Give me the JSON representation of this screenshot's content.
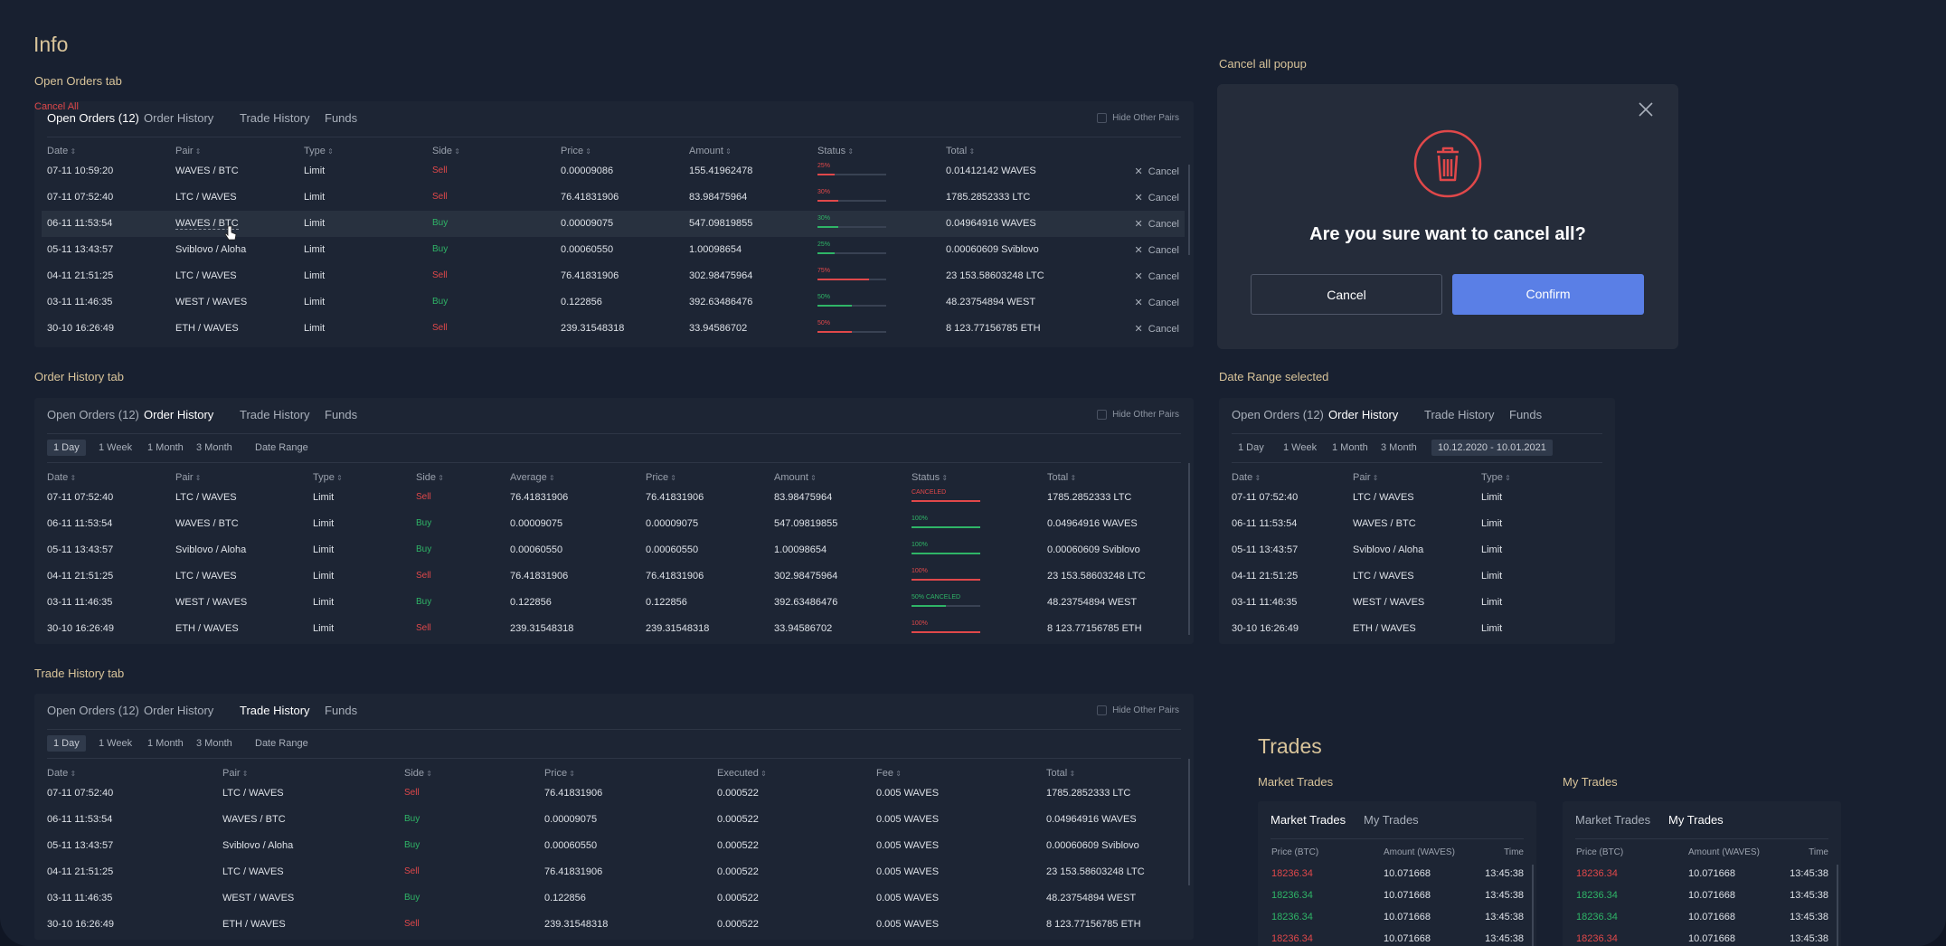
{
  "title": "Info",
  "sections": {
    "open_orders": "Open Orders tab",
    "order_history": "Order History tab",
    "trade_history": "Trade History tab",
    "cancel_popup": "Cancel all popup",
    "date_range": "Date Range selected"
  },
  "tabs": [
    "Open Orders (12)",
    "Order History",
    "Trade History",
    "Funds"
  ],
  "hide_other_pairs": "Hide Other Pairs",
  "filters": [
    "1 Day",
    "1 Week",
    "1 Month",
    "3 Month",
    "Date Range"
  ],
  "date_range_value": "10.12.2020 - 10.01.2021",
  "open_orders": {
    "headers": [
      "Date",
      "Pair",
      "Type",
      "Side",
      "Price",
      "Amount",
      "Status",
      "Total"
    ],
    "cancel_all": "Cancel All",
    "cancel_label": "Cancel",
    "rows": [
      {
        "date": "07-11 10:59:20",
        "pair": "WAVES / BTC",
        "type": "Limit",
        "side": "Sell",
        "price": "0.00009086",
        "amount": "155.41962478",
        "status": "25%",
        "fill": 0.25,
        "total": "0.01412142 WAVES"
      },
      {
        "date": "07-11 07:52:40",
        "pair": "LTC / WAVES",
        "type": "Limit",
        "side": "Sell",
        "price": "76.41831906",
        "amount": "83.98475964",
        "status": "30%",
        "fill": 0.3,
        "total": "1785.2852333 LTC"
      },
      {
        "date": "06-11 11:53:54",
        "pair": "WAVES / BTC",
        "type": "Limit",
        "side": "Buy",
        "price": "0.00009075",
        "amount": "547.09819855",
        "status": "30%",
        "fill": 0.3,
        "total": "0.04964916 WAVES"
      },
      {
        "date": "05-11 13:43:57",
        "pair": "Sviblovo / Aloha",
        "type": "Limit",
        "side": "Buy",
        "price": "0.00060550",
        "amount": "1.00098654",
        "status": "25%",
        "fill": 0.25,
        "total": "0.00060609 Sviblovo"
      },
      {
        "date": "04-11 21:51:25",
        "pair": "LTC / WAVES",
        "type": "Limit",
        "side": "Sell",
        "price": "76.41831906",
        "amount": "302.98475964",
        "status": "75%",
        "fill": 0.75,
        "total": "23 153.58603248 LTC"
      },
      {
        "date": "03-11 11:46:35",
        "pair": "WEST / WAVES",
        "type": "Limit",
        "side": "Buy",
        "price": "0.122856",
        "amount": "392.63486476",
        "status": "50%",
        "fill": 0.5,
        "total": "48.23754894 WEST"
      },
      {
        "date": "30-10 16:26:49",
        "pair": "ETH / WAVES",
        "type": "Limit",
        "side": "Sell",
        "price": "239.31548318",
        "amount": "33.94586702",
        "status": "50%",
        "fill": 0.5,
        "total": "8 123.77156785 ETH"
      }
    ]
  },
  "order_history": {
    "headers": [
      "Date",
      "Pair",
      "Type",
      "Side",
      "Average",
      "Price",
      "Amount",
      "Status",
      "Total"
    ],
    "rows": [
      {
        "date": "07-11 07:52:40",
        "pair": "LTC / WAVES",
        "type": "Limit",
        "side": "Sell",
        "average": "76.41831906",
        "price": "76.41831906",
        "amount": "83.98475964",
        "status": "CANCELED",
        "fill": 1,
        "total": "1785.2852333 LTC"
      },
      {
        "date": "06-11 11:53:54",
        "pair": "WAVES / BTC",
        "type": "Limit",
        "side": "Buy",
        "average": "0.00009075",
        "price": "0.00009075",
        "amount": "547.09819855",
        "status": "100%",
        "fill": 1,
        "total": "0.04964916 WAVES"
      },
      {
        "date": "05-11 13:43:57",
        "pair": "Sviblovo / Aloha",
        "type": "Limit",
        "side": "Buy",
        "average": "0.00060550",
        "price": "0.00060550",
        "amount": "1.00098654",
        "status": "100%",
        "fill": 1,
        "total": "0.00060609 Sviblovo"
      },
      {
        "date": "04-11 21:51:25",
        "pair": "LTC / WAVES",
        "type": "Limit",
        "side": "Sell",
        "average": "76.41831906",
        "price": "76.41831906",
        "amount": "302.98475964",
        "status": "100%",
        "fill": 1,
        "total": "23 153.58603248 LTC"
      },
      {
        "date": "03-11 11:46:35",
        "pair": "WEST / WAVES",
        "type": "Limit",
        "side": "Buy",
        "average": "0.122856",
        "price": "0.122856",
        "amount": "392.63486476",
        "status": "50% CANCELED",
        "fill": 0.5,
        "total": "48.23754894 WEST"
      },
      {
        "date": "30-10 16:26:49",
        "pair": "ETH / WAVES",
        "type": "Limit",
        "side": "Sell",
        "average": "239.31548318",
        "price": "239.31548318",
        "amount": "33.94586702",
        "status": "100%",
        "fill": 1,
        "total": "8 123.77156785 ETH"
      }
    ]
  },
  "trade_history": {
    "headers": [
      "Date",
      "Pair",
      "Side",
      "Price",
      "Executed",
      "Fee",
      "Total"
    ],
    "rows": [
      {
        "date": "07-11 07:52:40",
        "pair": "LTC / WAVES",
        "side": "Sell",
        "price": "76.41831906",
        "executed": "0.000522",
        "fee": "0.005 WAVES",
        "total": "1785.2852333 LTC"
      },
      {
        "date": "06-11 11:53:54",
        "pair": "WAVES / BTC",
        "side": "Buy",
        "price": "0.00009075",
        "executed": "0.000522",
        "fee": "0.005 WAVES",
        "total": "0.04964916 WAVES"
      },
      {
        "date": "05-11 13:43:57",
        "pair": "Sviblovo / Aloha",
        "side": "Buy",
        "price": "0.00060550",
        "executed": "0.000522",
        "fee": "0.005 WAVES",
        "total": "0.00060609 Sviblovo"
      },
      {
        "date": "04-11 21:51:25",
        "pair": "LTC / WAVES",
        "side": "Sell",
        "price": "76.41831906",
        "executed": "0.000522",
        "fee": "0.005 WAVES",
        "total": "23 153.58603248 LTC"
      },
      {
        "date": "03-11 11:46:35",
        "pair": "WEST / WAVES",
        "side": "Buy",
        "price": "0.122856",
        "executed": "0.000522",
        "fee": "0.005 WAVES",
        "total": "48.23754894 WEST"
      },
      {
        "date": "30-10 16:26:49",
        "pair": "ETH / WAVES",
        "side": "Sell",
        "price": "239.31548318",
        "executed": "0.000522",
        "fee": "0.005 WAVES",
        "total": "8 123.77156785 ETH"
      }
    ]
  },
  "date_range_panel": {
    "headers": [
      "Date",
      "Pair",
      "Type"
    ],
    "rows": [
      {
        "date": "07-11 07:52:40",
        "pair": "LTC / WAVES",
        "type": "Limit"
      },
      {
        "date": "06-11 11:53:54",
        "pair": "WAVES / BTC",
        "type": "Limit"
      },
      {
        "date": "05-11 13:43:57",
        "pair": "Sviblovo / Aloha",
        "type": "Limit"
      },
      {
        "date": "04-11 21:51:25",
        "pair": "LTC / WAVES",
        "type": "Limit"
      },
      {
        "date": "03-11 11:46:35",
        "pair": "WEST / WAVES",
        "type": "Limit"
      },
      {
        "date": "30-10 16:26:49",
        "pair": "ETH / WAVES",
        "type": "Limit"
      }
    ]
  },
  "popup": {
    "question": "Are you sure want to cancel all?",
    "cancel": "Cancel",
    "confirm": "Confirm"
  },
  "trades": {
    "title": "Trades",
    "market_label": "Market Trades",
    "my_label": "My Trades",
    "tab_market": "Market Trades",
    "tab_my": "My Trades",
    "headers": [
      "Price (BTC)",
      "Amount (WAVES)",
      "Time"
    ],
    "rows": [
      {
        "price": "18236.34",
        "amount": "10.071668",
        "time": "13:45:38",
        "side": "sell"
      },
      {
        "price": "18236.34",
        "amount": "10.071668",
        "time": "13:45:38",
        "side": "buy"
      },
      {
        "price": "18236.34",
        "amount": "10.071668",
        "time": "13:45:38",
        "side": "buy"
      },
      {
        "price": "18236.34",
        "amount": "10.071668",
        "time": "13:45:38",
        "side": "sell"
      }
    ]
  },
  "colors": {
    "accent": "#5a7fe6",
    "sell": "#e0484a",
    "buy": "#2fb567",
    "heading": "#d9c49a"
  }
}
